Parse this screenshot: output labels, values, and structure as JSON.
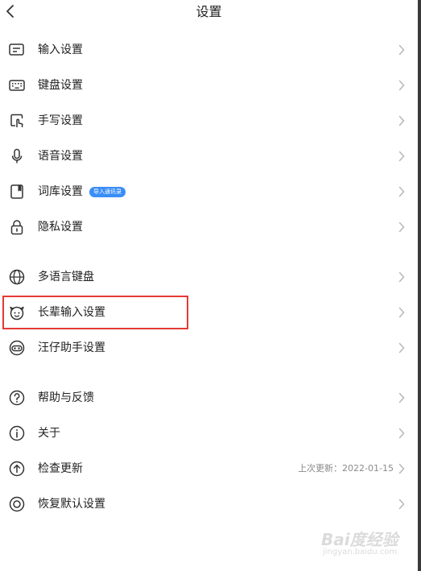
{
  "header": {
    "back_icon": "chevron-left-icon",
    "title": "设置"
  },
  "groups": [
    {
      "items": [
        {
          "label": "输入设置",
          "icon": "input-settings-icon"
        },
        {
          "label": "键盘设置",
          "icon": "keyboard-icon"
        },
        {
          "label": "手写设置",
          "icon": "handwriting-icon"
        },
        {
          "label": "语音设置",
          "icon": "microphone-icon"
        },
        {
          "label": "词库设置",
          "icon": "dictionary-icon",
          "badge": "导入通讯录"
        },
        {
          "label": "隐私设置",
          "icon": "lock-icon"
        }
      ]
    },
    {
      "items": [
        {
          "label": "多语言键盘",
          "icon": "globe-icon"
        },
        {
          "label": "长辈输入设置",
          "icon": "elder-face-icon",
          "highlighted": true
        },
        {
          "label": "汪仔助手设置",
          "icon": "dog-assistant-icon"
        }
      ]
    },
    {
      "items": [
        {
          "label": "帮助与反馈",
          "icon": "help-icon"
        },
        {
          "label": "关于",
          "icon": "info-icon"
        },
        {
          "label": "检查更新",
          "icon": "update-icon",
          "value": "上次更新：2022-01-15"
        },
        {
          "label": "恢复默认设置",
          "icon": "restore-icon"
        }
      ]
    }
  ],
  "colors": {
    "text": "#222222",
    "secondary": "#8a8a8a",
    "chevron": "#b5b5b5",
    "badge_bg": "#3a8ef6",
    "highlight_border": "#e53935"
  },
  "watermark": {
    "logo": "Bai度经验",
    "sub": "jingyan.baidu.com"
  }
}
